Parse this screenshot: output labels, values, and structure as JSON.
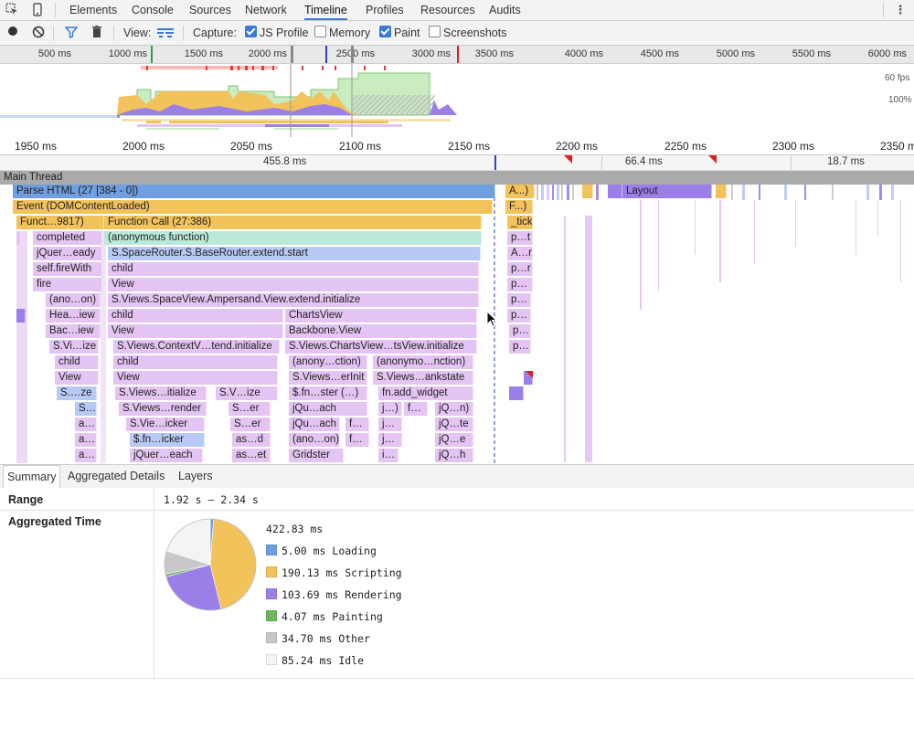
{
  "tabs": [
    "Elements",
    "Console",
    "Sources",
    "Network",
    "Timeline",
    "Profiles",
    "Resources",
    "Audits"
  ],
  "active_tab": "Timeline",
  "controls": {
    "view_label": "View:",
    "capture_label": "Capture:",
    "js_profile": "JS Profile",
    "memory": "Memory",
    "paint": "Paint",
    "screenshots": "Screenshots"
  },
  "overview_ticks": [
    "500 ms",
    "1000 ms",
    "1500 ms",
    "2000 ms",
    "2500 ms",
    "3000 ms",
    "3500 ms",
    "4000 ms",
    "4500 ms",
    "5000 ms",
    "5500 ms",
    "6000 ms"
  ],
  "overview_labels": {
    "fps": "60 fps",
    "cpu": "100%"
  },
  "detail_ticks": [
    "1950 ms",
    "2000 ms",
    "2050 ms",
    "2100 ms",
    "2150 ms",
    "2200 ms",
    "2250 ms",
    "2300 ms",
    "2350 ms"
  ],
  "frame_durations": [
    "455.8 ms",
    "66.4 ms",
    "18.7 ms"
  ],
  "main_thread_label": "Main Thread",
  "flame_bars": [
    {
      "row": 0,
      "l": 14,
      "w": 528,
      "c": "#6f9fe0",
      "t": "Parse HTML (27 [384 - 0])"
    },
    {
      "row": 0,
      "l": 553,
      "w": 32,
      "c": "#f2c25b",
      "t": "A...)"
    },
    {
      "row": 0,
      "l": 637,
      "w": 12,
      "c": "#f2c25b",
      "t": ""
    },
    {
      "row": 0,
      "l": 665,
      "w": 16,
      "c": "#9b7fe8",
      "t": ""
    },
    {
      "row": 0,
      "l": 681,
      "w": 98,
      "c": "#9b7fe8",
      "t": "Layout"
    },
    {
      "row": 0,
      "l": 783,
      "w": 12,
      "c": "#f2c25b",
      "t": ""
    },
    {
      "row": 1,
      "l": 14,
      "w": 525,
      "c": "#f2c25b",
      "t": "Event (DOMContentLoaded)"
    },
    {
      "row": 1,
      "l": 553,
      "w": 30,
      "c": "#f2c25b",
      "t": "F...)"
    },
    {
      "row": 2,
      "l": 18,
      "w": 96,
      "c": "#f2c25b",
      "t": "Funct…98​17)"
    },
    {
      "row": 2,
      "l": 114,
      "w": 413,
      "c": "#f2c25b",
      "t": "Function Call (27:386)"
    },
    {
      "row": 2,
      "l": 555,
      "w": 28,
      "c": "#f2c25b",
      "t": "_tick"
    },
    {
      "row": 3,
      "l": 18,
      "w": 4,
      "c": "#e2c6f0",
      "t": ""
    },
    {
      "row": 3,
      "l": 36,
      "w": 76,
      "c": "#e4c4f2",
      "t": "completed"
    },
    {
      "row": 3,
      "l": 114,
      "w": 413,
      "c": "#b9ead7",
      "t": "(anonymous function)"
    },
    {
      "row": 3,
      "l": 555,
      "w": 28,
      "c": "#e4c4f2",
      "t": "p…t"
    },
    {
      "row": 4,
      "l": 36,
      "w": 76,
      "c": "#e4c4f2",
      "t": "jQuer…eady"
    },
    {
      "row": 4,
      "l": 118,
      "w": 408,
      "c": "#b9c9f5",
      "t": "S.SpaceRouter.S.BaseRouter.extend.start"
    },
    {
      "row": 4,
      "l": 555,
      "w": 28,
      "c": "#e4c4f2",
      "t": "A…r"
    },
    {
      "row": 5,
      "l": 36,
      "w": 76,
      "c": "#e4c4f2",
      "t": "self.fireWith"
    },
    {
      "row": 5,
      "l": 118,
      "w": 406,
      "c": "#e4c4f2",
      "t": "child"
    },
    {
      "row": 5,
      "l": 555,
      "w": 28,
      "c": "#e4c4f2",
      "t": "p…r"
    },
    {
      "row": 6,
      "l": 36,
      "w": 76,
      "c": "#e4c4f2",
      "t": "fire"
    },
    {
      "row": 6,
      "l": 118,
      "w": 406,
      "c": "#e4c4f2",
      "t": "View"
    },
    {
      "row": 6,
      "l": 555,
      "w": 28,
      "c": "#e4c4f2",
      "t": "p…"
    },
    {
      "row": 7,
      "l": 50,
      "w": 60,
      "c": "#e4c4f2",
      "t": "(ano…on)"
    },
    {
      "row": 7,
      "l": 118,
      "w": 406,
      "c": "#e4c4f2",
      "t": "S.Views.SpaceView.Ampersand.View.extend.initialize"
    },
    {
      "row": 7,
      "l": 555,
      "w": 26,
      "c": "#e4c4f2",
      "t": "p…"
    },
    {
      "row": 8,
      "l": 18,
      "w": 10,
      "c": "#9b7fe8",
      "t": ""
    },
    {
      "row": 8,
      "l": 50,
      "w": 60,
      "c": "#e4c4f2",
      "t": "Hea…iew"
    },
    {
      "row": 8,
      "l": 118,
      "w": 192,
      "c": "#e4c4f2",
      "t": "child"
    },
    {
      "row": 8,
      "l": 312,
      "w": 210,
      "c": "#e4c4f2",
      "t": "ChartsView"
    },
    {
      "row": 8,
      "l": 555,
      "w": 26,
      "c": "#e4c4f2",
      "t": "p…"
    },
    {
      "row": 9,
      "l": 50,
      "w": 60,
      "c": "#e4c4f2",
      "t": "Bac…iew"
    },
    {
      "row": 9,
      "l": 118,
      "w": 192,
      "c": "#e4c4f2",
      "t": "View"
    },
    {
      "row": 9,
      "l": 312,
      "w": 210,
      "c": "#e4c4f2",
      "t": "Backbone.View"
    },
    {
      "row": 9,
      "l": 557,
      "w": 24,
      "c": "#e4c4f2",
      "t": "p…"
    },
    {
      "row": 10,
      "l": 54,
      "w": 54,
      "c": "#e4c4f2",
      "t": "S.Vi…ize"
    },
    {
      "row": 10,
      "l": 124,
      "w": 182,
      "c": "#e4c4f2",
      "t": "S.Views.ContextV…tend.initialize"
    },
    {
      "row": 10,
      "l": 312,
      "w": 210,
      "c": "#e4c4f2",
      "t": "S.Views.ChartsView…tsView.initialize"
    },
    {
      "row": 10,
      "l": 557,
      "w": 24,
      "c": "#e4c4f2",
      "t": "p…"
    },
    {
      "row": 11,
      "l": 60,
      "w": 48,
      "c": "#e4c4f2",
      "t": "child"
    },
    {
      "row": 11,
      "l": 124,
      "w": 180,
      "c": "#e4c4f2",
      "t": "child"
    },
    {
      "row": 11,
      "l": 316,
      "w": 86,
      "c": "#e4c4f2",
      "t": "(anony…ction)"
    },
    {
      "row": 11,
      "l": 408,
      "w": 110,
      "c": "#e4c4f2",
      "t": "(anonymo…nction)"
    },
    {
      "row": 12,
      "l": 60,
      "w": 48,
      "c": "#e4c4f2",
      "t": "View"
    },
    {
      "row": 12,
      "l": 124,
      "w": 180,
      "c": "#e4c4f2",
      "t": "View"
    },
    {
      "row": 12,
      "l": 316,
      "w": 86,
      "c": "#e4c4f2",
      "t": "S.Views…erInit"
    },
    {
      "row": 12,
      "l": 408,
      "w": 110,
      "c": "#e4c4f2",
      "t": "S.Views…ankstate"
    },
    {
      "row": 12,
      "l": 573,
      "w": 10,
      "c": "#9b7fe8",
      "t": ""
    },
    {
      "row": 13,
      "l": 62,
      "w": 44,
      "c": "#b9c9f5",
      "t": "S.…ze"
    },
    {
      "row": 13,
      "l": 126,
      "w": 100,
      "c": "#e4c4f2",
      "t": "S.Views…itialize"
    },
    {
      "row": 13,
      "l": 236,
      "w": 68,
      "c": "#e4c4f2",
      "t": "S.V…ize"
    },
    {
      "row": 13,
      "l": 316,
      "w": 86,
      "c": "#e4c4f2",
      "t": "$.fn…ster  (…)"
    },
    {
      "row": 13,
      "l": 414,
      "w": 104,
      "c": "#e4c4f2",
      "t": "fn.add_widget"
    },
    {
      "row": 13,
      "l": 557,
      "w": 16,
      "c": "#9b7fe8",
      "t": ""
    },
    {
      "row": 14,
      "l": 82,
      "w": 24,
      "c": "#b9c9f5",
      "t": "S…"
    },
    {
      "row": 14,
      "l": 130,
      "w": 96,
      "c": "#e4c4f2",
      "t": "S.Views…render"
    },
    {
      "row": 14,
      "l": 250,
      "w": 46,
      "c": "#e4c4f2",
      "t": "S…er"
    },
    {
      "row": 14,
      "l": 316,
      "w": 86,
      "c": "#e4c4f2",
      "t": "jQu…ach"
    },
    {
      "row": 14,
      "l": 414,
      "w": 26,
      "c": "#e4c4f2",
      "t": "j…)"
    },
    {
      "row": 14,
      "l": 442,
      "w": 26,
      "c": "#e4c4f2",
      "t": "f…"
    },
    {
      "row": 14,
      "l": 476,
      "w": 42,
      "c": "#e4c4f2",
      "t": "jQ…n)"
    },
    {
      "row": 15,
      "l": 82,
      "w": 24,
      "c": "#e4c4f2",
      "t": "a…"
    },
    {
      "row": 15,
      "l": 138,
      "w": 86,
      "c": "#e4c4f2",
      "t": "S.Vie…icker"
    },
    {
      "row": 15,
      "l": 252,
      "w": 44,
      "c": "#e4c4f2",
      "t": "S…er"
    },
    {
      "row": 15,
      "l": 316,
      "w": 56,
      "c": "#e4c4f2",
      "t": "jQu…ach"
    },
    {
      "row": 15,
      "l": 378,
      "w": 26,
      "c": "#e4c4f2",
      "t": "f…"
    },
    {
      "row": 15,
      "l": 414,
      "w": 26,
      "c": "#e4c4f2",
      "t": "j…"
    },
    {
      "row": 15,
      "l": 476,
      "w": 42,
      "c": "#e4c4f2",
      "t": "jQ…te"
    },
    {
      "row": 16,
      "l": 82,
      "w": 24,
      "c": "#e4c4f2",
      "t": "a…"
    },
    {
      "row": 16,
      "l": 142,
      "w": 82,
      "c": "#b9c9f5",
      "t": "$.fn…icker"
    },
    {
      "row": 16,
      "l": 254,
      "w": 42,
      "c": "#e4c4f2",
      "t": "as…d"
    },
    {
      "row": 16,
      "l": 316,
      "w": 56,
      "c": "#e4c4f2",
      "t": "(ano…on)"
    },
    {
      "row": 16,
      "l": 378,
      "w": 26,
      "c": "#e4c4f2",
      "t": "f…"
    },
    {
      "row": 16,
      "l": 414,
      "w": 26,
      "c": "#e4c4f2",
      "t": "j…"
    },
    {
      "row": 16,
      "l": 476,
      "w": 42,
      "c": "#e4c4f2",
      "t": "jQ…e"
    },
    {
      "row": 17,
      "l": 82,
      "w": 24,
      "c": "#e4c4f2",
      "t": "a…"
    },
    {
      "row": 17,
      "l": 142,
      "w": 80,
      "c": "#e4c4f2",
      "t": "jQuer…each"
    },
    {
      "row": 17,
      "l": 254,
      "w": 42,
      "c": "#e4c4f2",
      "t": "as…et"
    },
    {
      "row": 17,
      "l": 316,
      "w": 60,
      "c": "#e4c4f2",
      "t": "Gridster"
    },
    {
      "row": 17,
      "l": 414,
      "w": 22,
      "c": "#e4c4f2",
      "t": "i…"
    },
    {
      "row": 17,
      "l": 476,
      "w": 42,
      "c": "#e4c4f2",
      "t": "jQ…h"
    }
  ],
  "bottom_tabs": [
    "Summary",
    "Aggregated Details",
    "Layers"
  ],
  "summary": {
    "range_label": "Range",
    "range_value": "1.92 s – 2.34 s",
    "agg_label": "Aggregated Time",
    "total": "422.83 ms",
    "items": [
      {
        "value": "5.00 ms",
        "name": "Loading",
        "color": "#6f9fe0",
        "ms": 5.0
      },
      {
        "value": "190.13 ms",
        "name": "Scripting",
        "color": "#f2c25b",
        "ms": 190.13
      },
      {
        "value": "103.69 ms",
        "name": "Rendering",
        "color": "#9b7fe8",
        "ms": 103.69
      },
      {
        "value": "4.07 ms",
        "name": "Painting",
        "color": "#71b363",
        "ms": 4.07
      },
      {
        "value": "34.70 ms",
        "name": "Other",
        "color": "#c8c8c8",
        "ms": 34.7
      },
      {
        "value": "85.24 ms",
        "name": "Idle",
        "color": "#f4f4f4",
        "ms": 85.24
      }
    ]
  }
}
